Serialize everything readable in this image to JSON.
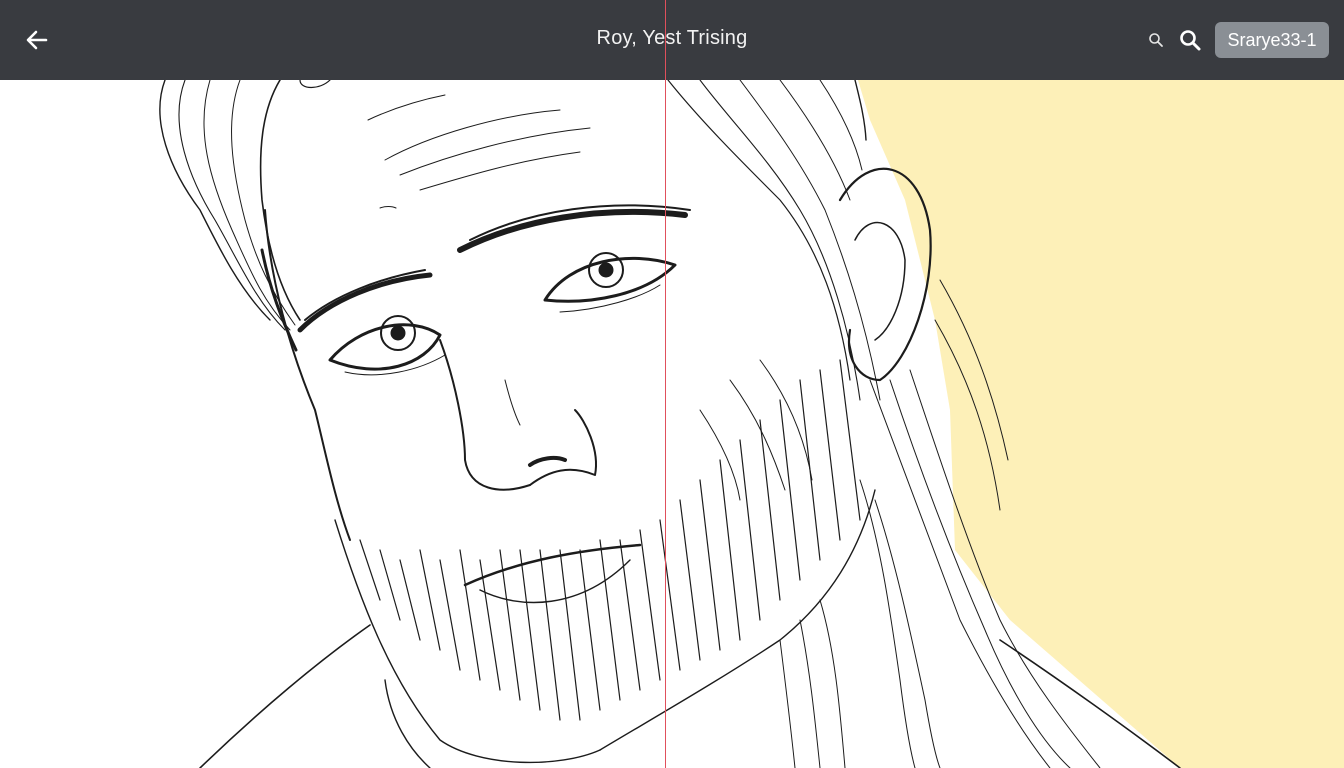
{
  "header": {
    "title": "Roy, Yest Trising",
    "page_label": "Srarye33-1"
  },
  "icons": {
    "back": "back-arrow-icon",
    "search_small": "search-icon",
    "search_large": "search-icon"
  },
  "colors": {
    "toolbar": "#393b40",
    "chip": "#8a8f95",
    "guide": "#e0505c",
    "highlight": "#fdf0b8"
  }
}
